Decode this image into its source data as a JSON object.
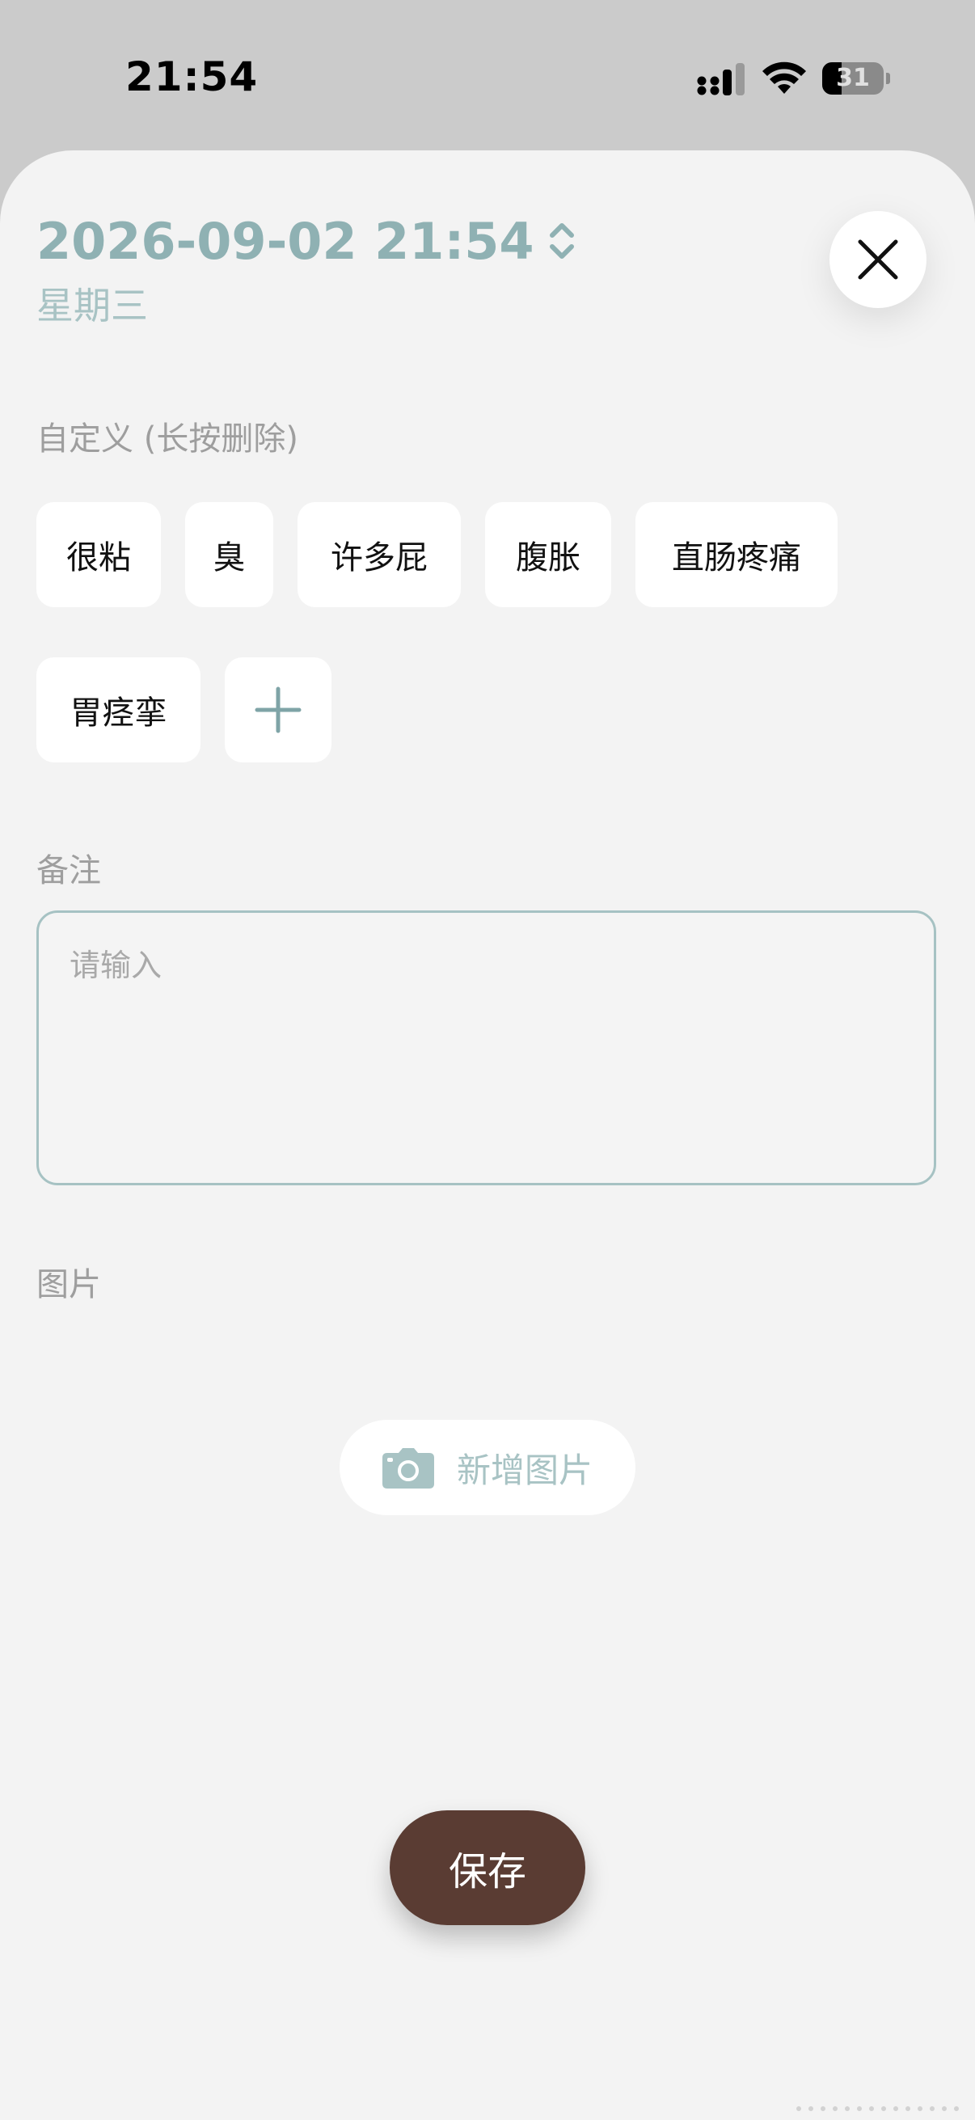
{
  "status_bar": {
    "time": "21:54",
    "battery_level": "31",
    "battery_fraction": 0.31,
    "icons": [
      "cellular-signal-icon",
      "wifi-icon",
      "battery-icon"
    ]
  },
  "header": {
    "datetime": "2026-09-02 21:54",
    "weekday": "星期三",
    "chevron_icon": "chevron-up-down-icon",
    "close_icon": "close-icon"
  },
  "custom": {
    "label": "自定义 (长按删除)",
    "tags": [
      "很粘",
      "臭",
      "许多屁",
      "腹胀",
      "直肠疼痛",
      "胃痉挛"
    ],
    "add_icon": "plus-icon"
  },
  "note": {
    "label": "备注",
    "value": "",
    "placeholder": "请输入"
  },
  "photos": {
    "label": "图片",
    "add_label": "新增图片",
    "add_icon": "camera-icon"
  },
  "actions": {
    "save_label": "保存"
  },
  "colors": {
    "accent": "#8fb1b3",
    "accent_light": "#a8c3c4",
    "save_button": "#5a3c33",
    "sheet_background": "#f3f3f3",
    "status_background": "#cbcbcb"
  }
}
